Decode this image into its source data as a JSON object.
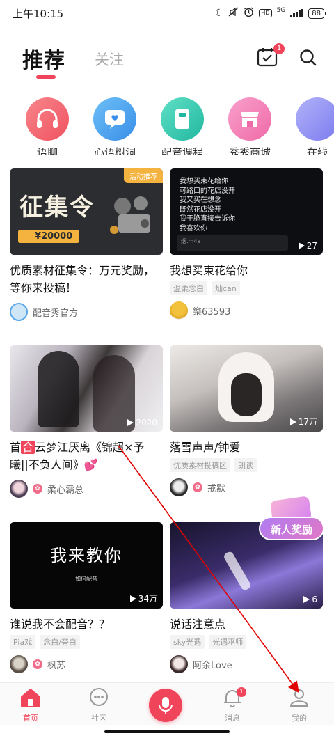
{
  "status_bar": {
    "time": "上午10:15",
    "network": "5G",
    "battery": "88"
  },
  "header": {
    "tab_active": "推荐",
    "tab_inactive": "关注",
    "checkin_badge": "1"
  },
  "categories": [
    {
      "label": "语聊",
      "icon": "headphones-icon",
      "color": "#f36a70"
    },
    {
      "label": "心语树洞",
      "icon": "heart-chat-icon",
      "color": "#4aa6ee"
    },
    {
      "label": "配音课程",
      "icon": "course-book-icon",
      "color": "#33ccb4"
    },
    {
      "label": "秀秀商城",
      "icon": "shop-icon",
      "color": "#f47fb6"
    },
    {
      "label": "在线",
      "icon": "online-icon",
      "color": "#8f8ff2"
    }
  ],
  "cards": [
    {
      "banner_label": "活动推荐",
      "thumb_big": "征集令",
      "thumb_prize": "¥20000",
      "title": "优质素材征集令：万元奖励，等你来投稿！",
      "tags": [],
      "author": "配音秀官方"
    },
    {
      "thumb_lines": [
        "我想买束花给你",
        "可路口的花店没开",
        "我又买在想念",
        "既然花店没开",
        "我于脆直接告诉你",
        "我喜欢你"
      ],
      "thumb_file": "烟.m4a",
      "play_count": "27",
      "title": "我想买束花给你",
      "tags": [
        "温柔念白",
        "灿can"
      ],
      "author": "樂63593"
    },
    {
      "play_count": "2020",
      "title_hot": "合",
      "title_pre": "首",
      "title_post": "云梦江厌离《锦超×予曦||不负人间》💕",
      "tags": [],
      "author": "柔心霸总"
    },
    {
      "play_count": "17万",
      "title": "落雪声声/钟爱",
      "tags": [
        "优质素材投稿区",
        "朗读"
      ],
      "author": "戒默"
    },
    {
      "thumb_text": "我来教你",
      "thumb_sub": "如何配音",
      "play_count": "34万",
      "title": "谁说我不会配音？？",
      "tags": [
        "Pia戏",
        "念白/旁白"
      ],
      "author": "枫苏"
    },
    {
      "thumb_badge": "新人奖励",
      "play_count": "6",
      "title": "说话注意点",
      "tags": [
        "sky光遇",
        "光遇巫师"
      ],
      "author": "阿余Love"
    }
  ],
  "bottom_nav": {
    "home": "首页",
    "community": "社区",
    "messages": "消息",
    "messages_badge": "1",
    "profile": "我的"
  },
  "colors": {
    "accent": "#f0445a",
    "annotation_arrow": "#e00000"
  }
}
